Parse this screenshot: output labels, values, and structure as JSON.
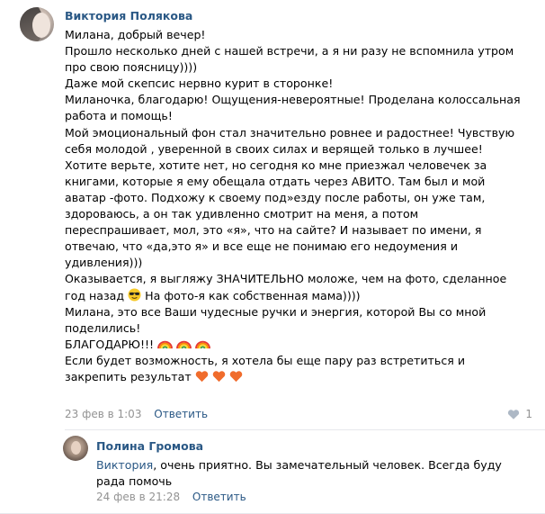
{
  "comment": {
    "author": "Виктория Полякова",
    "lines": [
      "Милана, добрый вечер!",
      "Прошло несколько дней с нашей встречи, а я ни разу не вспомнила утром",
      "про свою поясницу))))",
      "Даже мой скепсис нервно курит в сторонке!",
      "Миланочка, благодарю! Ощущения-невероятные! Проделана колоссальная",
      "работа и помощь!",
      "Мой эмоциональный фон стал значительно ровнее и радостнее! Чувствую",
      "себя молодой , уверенной в своих силах и верящей только в лучшее!",
      "Хотите верьте, хотите нет, но сегодня ко мне приезжал человечек за",
      "книгами, которые я ему обещала отдать через АВИТО. Там был и мой",
      "аватар -фото. Подхожу к своему под»езду после работы, он уже там,",
      "здороваюсь, а он так удивленно смотрит на меня, а потом",
      "переспрашивает, мол, это «я», что на сайте? И называет по имени, я",
      "отвечаю, что «да,это я» и все еще не понимаю его недоумения и",
      "удивления)))",
      "Оказывается, я выгляжу ЗНАЧИТЕЛЬНО моложе, чем на фото, сделанное"
    ],
    "line_17_a": "год назад",
    "line_17_b": " На фото-я как собственная мама))))",
    "line_18": "Милана, это все Ваши чудесные ручки и энергия, которой Вы со мной",
    "line_19": "поделились!",
    "line_20": "БЛАГОДАРЮ!!!",
    "line_21": "Если будет возможность, я хотела бы еще пару раз встретиться и",
    "line_22": "закрепить результат",
    "date": "23 фев в 1:03",
    "reply_label": "Ответить",
    "likes": "1"
  },
  "reply": {
    "author": "Полина Громова",
    "addressee": "Виктория",
    "text_1": ", очень приятно. Вы замечательный человек. Всегда буду",
    "text_2": "рада помочь",
    "date": "24 фев в 21:28",
    "reply_label": "Ответить"
  },
  "icons": {
    "emoji_sunglasses": "sunglasses-emoji-icon",
    "emoji_rainbow": "rainbow-emoji-icon",
    "emoji_heart": "heart-emoji-icon",
    "like": "heart-like-icon"
  },
  "colors": {
    "link": "#2a5885",
    "meta": "#939393",
    "heart": "#f06c2c"
  }
}
